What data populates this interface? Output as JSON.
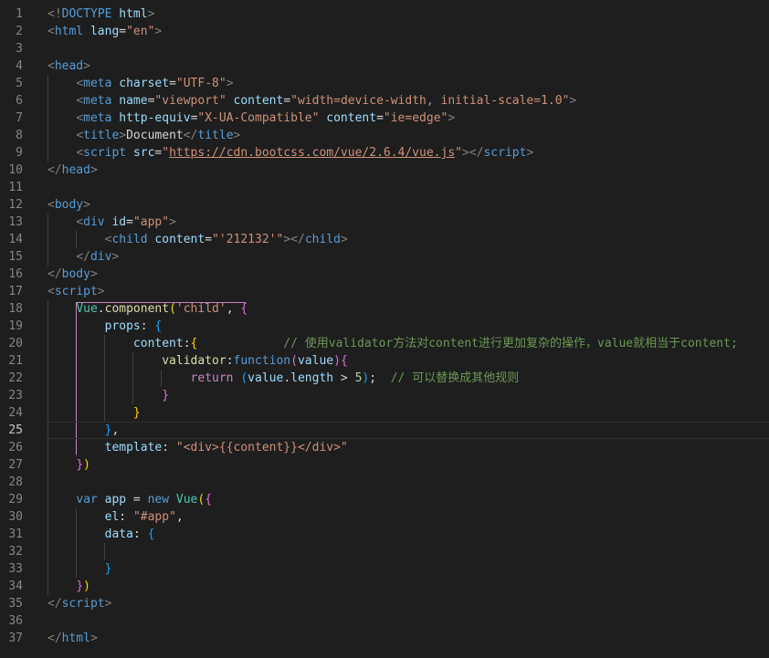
{
  "editor": {
    "colors": {
      "background": "#1e1e1e",
      "tag": "#569cd6",
      "attr": "#9cdcfe",
      "string": "#ce9178",
      "comment": "#6a9955",
      "text": "#d4d4d4",
      "class": "#4ec9b0",
      "func": "#dcdcaa",
      "control": "#c586c0",
      "number": "#b5cea8",
      "bracket_yellow": "#ffd700",
      "bracket_purple": "#da70d6",
      "bracket_blue": "#179fff"
    },
    "current_line": 25,
    "lines": [
      {
        "n": "1",
        "tokens": [
          [
            "p",
            "<!"
          ],
          [
            "t",
            "DOCTYPE"
          ],
          [
            "x",
            " "
          ],
          [
            "a",
            "html"
          ],
          [
            "p",
            ">"
          ]
        ]
      },
      {
        "n": "2",
        "tokens": [
          [
            "p",
            "<"
          ],
          [
            "t",
            "html"
          ],
          [
            "x",
            " "
          ],
          [
            "a",
            "lang"
          ],
          [
            "x",
            "="
          ],
          [
            "s",
            "\"en\""
          ],
          [
            "p",
            ">"
          ]
        ]
      },
      {
        "n": "3",
        "tokens": []
      },
      {
        "n": "4",
        "tokens": [
          [
            "p",
            "<"
          ],
          [
            "t",
            "head"
          ],
          [
            "p",
            ">"
          ]
        ]
      },
      {
        "n": "5",
        "tokens": [
          [
            "x",
            "    "
          ],
          [
            "p",
            "<"
          ],
          [
            "t",
            "meta"
          ],
          [
            "x",
            " "
          ],
          [
            "a",
            "charset"
          ],
          [
            "x",
            "="
          ],
          [
            "s",
            "\"UTF-8\""
          ],
          [
            "p",
            ">"
          ]
        ]
      },
      {
        "n": "6",
        "tokens": [
          [
            "x",
            "    "
          ],
          [
            "p",
            "<"
          ],
          [
            "t",
            "meta"
          ],
          [
            "x",
            " "
          ],
          [
            "a",
            "name"
          ],
          [
            "x",
            "="
          ],
          [
            "s",
            "\"viewport\""
          ],
          [
            "x",
            " "
          ],
          [
            "a",
            "content"
          ],
          [
            "x",
            "="
          ],
          [
            "s",
            "\"width=device-width, initial-scale=1.0\""
          ],
          [
            "p",
            ">"
          ]
        ]
      },
      {
        "n": "7",
        "tokens": [
          [
            "x",
            "    "
          ],
          [
            "p",
            "<"
          ],
          [
            "t",
            "meta"
          ],
          [
            "x",
            " "
          ],
          [
            "a",
            "http-equiv"
          ],
          [
            "x",
            "="
          ],
          [
            "s",
            "\"X-UA-Compatible\""
          ],
          [
            "x",
            " "
          ],
          [
            "a",
            "content"
          ],
          [
            "x",
            "="
          ],
          [
            "s",
            "\"ie=edge\""
          ],
          [
            "p",
            ">"
          ]
        ]
      },
      {
        "n": "8",
        "tokens": [
          [
            "x",
            "    "
          ],
          [
            "p",
            "<"
          ],
          [
            "t",
            "title"
          ],
          [
            "p",
            ">"
          ],
          [
            "x",
            "Document"
          ],
          [
            "p",
            "</"
          ],
          [
            "t",
            "title"
          ],
          [
            "p",
            ">"
          ]
        ]
      },
      {
        "n": "9",
        "tokens": [
          [
            "x",
            "    "
          ],
          [
            "p",
            "<"
          ],
          [
            "t",
            "script"
          ],
          [
            "x",
            " "
          ],
          [
            "a",
            "src"
          ],
          [
            "x",
            "="
          ],
          [
            "s",
            "\""
          ],
          [
            "su",
            "https://cdn.bootcss.com/vue/2.6.4/vue.js"
          ],
          [
            "s",
            "\""
          ],
          [
            "p",
            "></"
          ],
          [
            "t",
            "script"
          ],
          [
            "p",
            ">"
          ]
        ]
      },
      {
        "n": "10",
        "tokens": [
          [
            "p",
            "</"
          ],
          [
            "t",
            "head"
          ],
          [
            "p",
            ">"
          ]
        ]
      },
      {
        "n": "11",
        "tokens": []
      },
      {
        "n": "12",
        "tokens": [
          [
            "p",
            "<"
          ],
          [
            "t",
            "body"
          ],
          [
            "p",
            ">"
          ]
        ]
      },
      {
        "n": "13",
        "tokens": [
          [
            "x",
            "    "
          ],
          [
            "p",
            "<"
          ],
          [
            "t",
            "div"
          ],
          [
            "x",
            " "
          ],
          [
            "a",
            "id"
          ],
          [
            "x",
            "="
          ],
          [
            "s",
            "\"app\""
          ],
          [
            "p",
            ">"
          ]
        ]
      },
      {
        "n": "14",
        "tokens": [
          [
            "x",
            "        "
          ],
          [
            "p",
            "<"
          ],
          [
            "t",
            "child"
          ],
          [
            "x",
            " "
          ],
          [
            "a",
            "content"
          ],
          [
            "x",
            "="
          ],
          [
            "s",
            "\"'212132'\""
          ],
          [
            "p",
            "></"
          ],
          [
            "t",
            "child"
          ],
          [
            "p",
            ">"
          ]
        ]
      },
      {
        "n": "15",
        "tokens": [
          [
            "x",
            "    "
          ],
          [
            "p",
            "</"
          ],
          [
            "t",
            "div"
          ],
          [
            "p",
            ">"
          ]
        ]
      },
      {
        "n": "16",
        "tokens": [
          [
            "p",
            "</"
          ],
          [
            "t",
            "body"
          ],
          [
            "p",
            ">"
          ]
        ]
      },
      {
        "n": "17",
        "tokens": [
          [
            "p",
            "<"
          ],
          [
            "t",
            "script"
          ],
          [
            "p",
            ">"
          ]
        ]
      },
      {
        "n": "18",
        "tokens": [
          [
            "x",
            "    "
          ],
          [
            "c",
            "Vue"
          ],
          [
            "x",
            "."
          ],
          [
            "f",
            "component"
          ],
          [
            "by",
            "("
          ],
          [
            "s",
            "'child'"
          ],
          [
            "x",
            ", "
          ],
          [
            "bp",
            "{"
          ]
        ]
      },
      {
        "n": "19",
        "tokens": [
          [
            "x",
            "        "
          ],
          [
            "v",
            "props"
          ],
          [
            "x",
            ": "
          ],
          [
            "bb",
            "{"
          ]
        ]
      },
      {
        "n": "20",
        "tokens": [
          [
            "x",
            "            "
          ],
          [
            "v",
            "content"
          ],
          [
            "x",
            ":"
          ],
          [
            "by",
            "{"
          ],
          [
            "x",
            "            "
          ],
          [
            "m",
            "// 使用validator方法对content进行更加复杂的操作，value就相当于content;"
          ]
        ]
      },
      {
        "n": "21",
        "tokens": [
          [
            "x",
            "                "
          ],
          [
            "f",
            "validator"
          ],
          [
            "x",
            ":"
          ],
          [
            "t",
            "function"
          ],
          [
            "bp",
            "("
          ],
          [
            "v",
            "value"
          ],
          [
            "bp",
            ")"
          ],
          [
            "bp",
            "{"
          ]
        ]
      },
      {
        "n": "22",
        "tokens": [
          [
            "x",
            "                    "
          ],
          [
            "k",
            "return"
          ],
          [
            "x",
            " "
          ],
          [
            "bb",
            "("
          ],
          [
            "v",
            "value"
          ],
          [
            "x",
            "."
          ],
          [
            "v",
            "length"
          ],
          [
            "x",
            " > "
          ],
          [
            "n",
            "5"
          ],
          [
            "bb",
            ")"
          ],
          [
            "x",
            ";  "
          ],
          [
            "m",
            "// 可以替换成其他规则"
          ]
        ]
      },
      {
        "n": "23",
        "tokens": [
          [
            "x",
            "                "
          ],
          [
            "bp",
            "}"
          ]
        ]
      },
      {
        "n": "24",
        "tokens": [
          [
            "x",
            "            "
          ],
          [
            "by",
            "}"
          ]
        ]
      },
      {
        "n": "25",
        "tokens": [
          [
            "x",
            "        "
          ],
          [
            "bb",
            "}"
          ],
          [
            "x",
            ","
          ]
        ]
      },
      {
        "n": "26",
        "tokens": [
          [
            "x",
            "        "
          ],
          [
            "v",
            "template"
          ],
          [
            "x",
            ": "
          ],
          [
            "s",
            "\"<div>{{content}}</div>\""
          ]
        ]
      },
      {
        "n": "27",
        "tokens": [
          [
            "x",
            "    "
          ],
          [
            "bp",
            "}"
          ],
          [
            "by",
            ")"
          ]
        ]
      },
      {
        "n": "28",
        "tokens": []
      },
      {
        "n": "29",
        "tokens": [
          [
            "x",
            "    "
          ],
          [
            "t",
            "var"
          ],
          [
            "x",
            " "
          ],
          [
            "v",
            "app"
          ],
          [
            "x",
            " = "
          ],
          [
            "t",
            "new"
          ],
          [
            "x",
            " "
          ],
          [
            "c",
            "Vue"
          ],
          [
            "by",
            "("
          ],
          [
            "bp",
            "{"
          ]
        ]
      },
      {
        "n": "30",
        "tokens": [
          [
            "x",
            "        "
          ],
          [
            "v",
            "el"
          ],
          [
            "x",
            ": "
          ],
          [
            "s",
            "\"#app\""
          ],
          [
            "x",
            ","
          ]
        ]
      },
      {
        "n": "31",
        "tokens": [
          [
            "x",
            "        "
          ],
          [
            "v",
            "data"
          ],
          [
            "x",
            ": "
          ],
          [
            "bb",
            "{"
          ]
        ]
      },
      {
        "n": "32",
        "tokens": []
      },
      {
        "n": "33",
        "tokens": [
          [
            "x",
            "        "
          ],
          [
            "bb",
            "}"
          ]
        ]
      },
      {
        "n": "34",
        "tokens": [
          [
            "x",
            "    "
          ],
          [
            "bp",
            "}"
          ],
          [
            "by",
            ")"
          ]
        ]
      },
      {
        "n": "35",
        "tokens": [
          [
            "p",
            "</"
          ],
          [
            "t",
            "script"
          ],
          [
            "p",
            ">"
          ]
        ]
      },
      {
        "n": "36",
        "tokens": []
      },
      {
        "n": "37",
        "tokens": [
          [
            "p",
            "</"
          ],
          [
            "t",
            "html"
          ],
          [
            "p",
            ">"
          ]
        ]
      }
    ]
  }
}
